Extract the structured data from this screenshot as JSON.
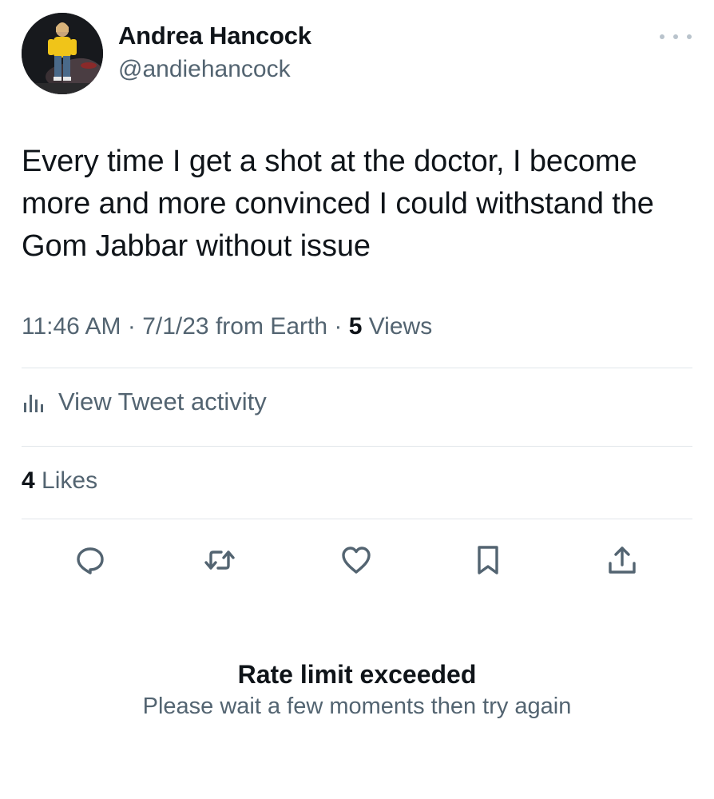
{
  "author": {
    "display_name": "Andrea Hancock",
    "handle": "@andiehancock"
  },
  "tweet": {
    "text": "Every time I get a shot at the doctor, I become more and more convinced I could withstand the Gom Jabbar without issue",
    "time": "11:46 AM",
    "date": "7/1/23",
    "source": "from Earth",
    "views_count": "5",
    "views_label": "Views"
  },
  "activity": {
    "label": "View Tweet activity"
  },
  "likes": {
    "count": "4",
    "label": "Likes"
  },
  "actions": [
    "reply-icon",
    "retweet-icon",
    "like-icon",
    "bookmark-icon",
    "share-icon"
  ],
  "rate_limit": {
    "title": "Rate limit exceeded",
    "message": "Please wait a few moments then try again"
  },
  "colors": {
    "text_primary": "#0f1419",
    "text_secondary": "#536471",
    "divider": "#e1e6ea",
    "icon": "#536471"
  }
}
